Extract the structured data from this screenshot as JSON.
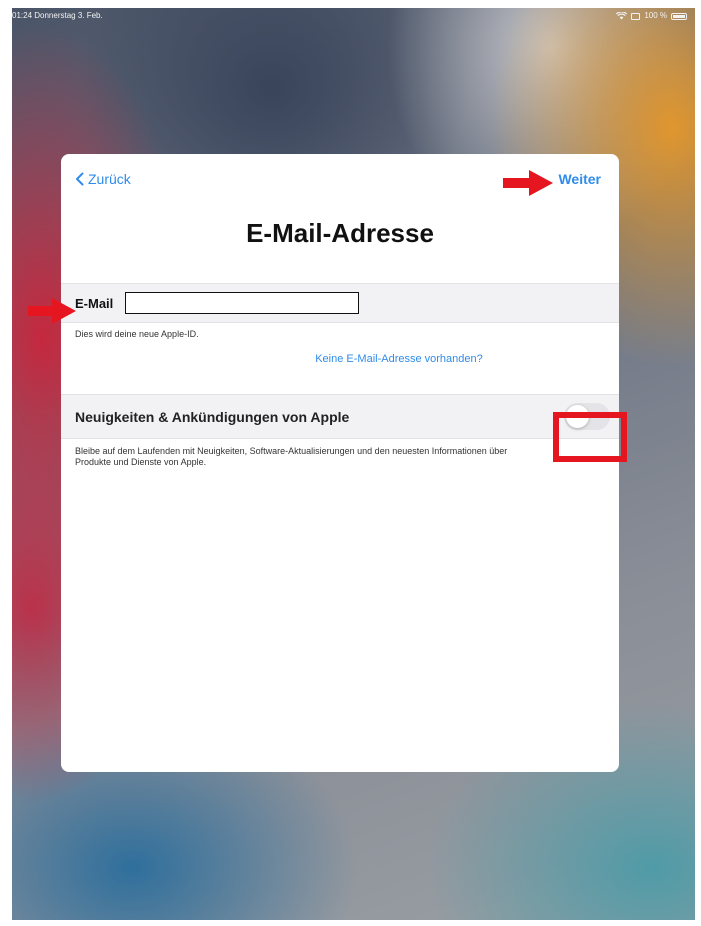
{
  "status_bar": {
    "time_date": "01:24  Donnerstag 3. Feb.",
    "battery": "100 %"
  },
  "nav": {
    "back_label": "Zurück",
    "next_label": "Weiter"
  },
  "page_title": "E-Mail-Adresse",
  "email": {
    "label": "E-Mail",
    "value": "",
    "hint": "Dies wird deine neue Apple-ID.",
    "no_email_link": "Keine E-Mail-Adresse vorhanden?"
  },
  "news": {
    "label": "Neuigkeiten & Ankündigungen von Apple",
    "toggle_on": false,
    "description": "Bleibe auf dem Laufenden mit Neuigkeiten, Software-Aktualisierungen und den neuesten Informationen über Produkte und Dienste von Apple."
  },
  "colors": {
    "accent": "#2f8cea",
    "annotation": "#e5161f",
    "toggle_off": "#e4e4e8"
  },
  "icons": [
    "chevron-left-icon",
    "wifi-icon",
    "battery-icon",
    "arrow-right-icon"
  ]
}
